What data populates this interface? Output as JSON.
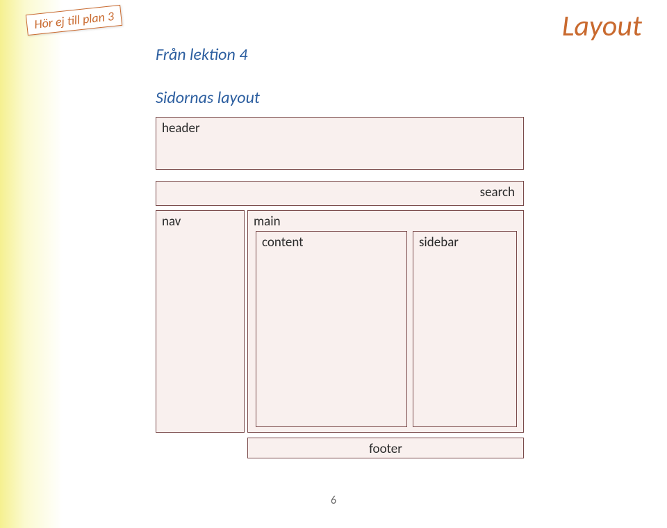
{
  "note": "Hör ej till plan 3",
  "title": "Layout",
  "subtitle1": "Från lektion 4",
  "subtitle2": "Sidornas layout",
  "boxes": {
    "header": "header",
    "search": "search",
    "nav": "nav",
    "main": "main",
    "content": "content",
    "sidebar": "sidebar",
    "footer": "footer"
  },
  "pageNumber": "6"
}
